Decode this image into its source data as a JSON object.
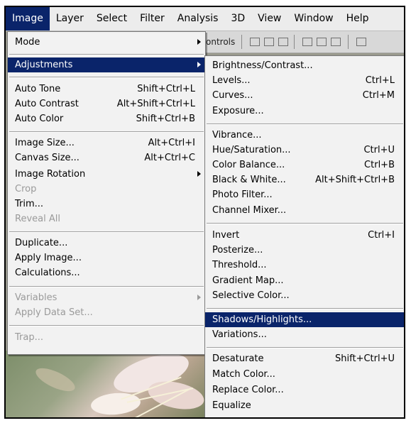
{
  "menubar": {
    "items": [
      "Image",
      "Layer",
      "Select",
      "Filter",
      "Analysis",
      "3D",
      "View",
      "Window",
      "Help"
    ]
  },
  "options_bar": {
    "partial_label": "ontrols"
  },
  "image_menu": {
    "items": [
      {
        "label": "Mode",
        "shortcut": "",
        "submenu": true,
        "disabled": false,
        "highlighted": false
      },
      {
        "label": "Adjustments",
        "shortcut": "",
        "submenu": true,
        "disabled": false,
        "highlighted": true
      },
      {
        "label": "Auto Tone",
        "shortcut": "Shift+Ctrl+L",
        "submenu": false,
        "disabled": false,
        "highlighted": false
      },
      {
        "label": "Auto Contrast",
        "shortcut": "Alt+Shift+Ctrl+L",
        "submenu": false,
        "disabled": false,
        "highlighted": false
      },
      {
        "label": "Auto Color",
        "shortcut": "Shift+Ctrl+B",
        "submenu": false,
        "disabled": false,
        "highlighted": false
      },
      {
        "label": "Image Size...",
        "shortcut": "Alt+Ctrl+I",
        "submenu": false,
        "disabled": false,
        "highlighted": false
      },
      {
        "label": "Canvas Size...",
        "shortcut": "Alt+Ctrl+C",
        "submenu": false,
        "disabled": false,
        "highlighted": false
      },
      {
        "label": "Image Rotation",
        "shortcut": "",
        "submenu": true,
        "disabled": false,
        "highlighted": false
      },
      {
        "label": "Crop",
        "shortcut": "",
        "submenu": false,
        "disabled": true,
        "highlighted": false
      },
      {
        "label": "Trim...",
        "shortcut": "",
        "submenu": false,
        "disabled": false,
        "highlighted": false
      },
      {
        "label": "Reveal All",
        "shortcut": "",
        "submenu": false,
        "disabled": true,
        "highlighted": false
      },
      {
        "label": "Duplicate...",
        "shortcut": "",
        "submenu": false,
        "disabled": false,
        "highlighted": false
      },
      {
        "label": "Apply Image...",
        "shortcut": "",
        "submenu": false,
        "disabled": false,
        "highlighted": false
      },
      {
        "label": "Calculations...",
        "shortcut": "",
        "submenu": false,
        "disabled": false,
        "highlighted": false
      },
      {
        "label": "Variables",
        "shortcut": "",
        "submenu": true,
        "disabled": true,
        "highlighted": false
      },
      {
        "label": "Apply Data Set...",
        "shortcut": "",
        "submenu": false,
        "disabled": true,
        "highlighted": false
      },
      {
        "label": "Trap...",
        "shortcut": "",
        "submenu": false,
        "disabled": true,
        "highlighted": false
      }
    ]
  },
  "adjustments_menu": {
    "items": [
      {
        "label": "Brightness/Contrast...",
        "shortcut": "",
        "highlighted": false
      },
      {
        "label": "Levels...",
        "shortcut": "Ctrl+L",
        "highlighted": false
      },
      {
        "label": "Curves...",
        "shortcut": "Ctrl+M",
        "highlighted": false
      },
      {
        "label": "Exposure...",
        "shortcut": "",
        "highlighted": false
      },
      {
        "label": "Vibrance...",
        "shortcut": "",
        "highlighted": false
      },
      {
        "label": "Hue/Saturation...",
        "shortcut": "Ctrl+U",
        "highlighted": false
      },
      {
        "label": "Color Balance...",
        "shortcut": "Ctrl+B",
        "highlighted": false
      },
      {
        "label": "Black & White...",
        "shortcut": "Alt+Shift+Ctrl+B",
        "highlighted": false
      },
      {
        "label": "Photo Filter...",
        "shortcut": "",
        "highlighted": false
      },
      {
        "label": "Channel Mixer...",
        "shortcut": "",
        "highlighted": false
      },
      {
        "label": "Invert",
        "shortcut": "Ctrl+I",
        "highlighted": false
      },
      {
        "label": "Posterize...",
        "shortcut": "",
        "highlighted": false
      },
      {
        "label": "Threshold...",
        "shortcut": "",
        "highlighted": false
      },
      {
        "label": "Gradient Map...",
        "shortcut": "",
        "highlighted": false
      },
      {
        "label": "Selective Color...",
        "shortcut": "",
        "highlighted": false
      },
      {
        "label": "Shadows/Highlights...",
        "shortcut": "",
        "highlighted": true
      },
      {
        "label": "Variations...",
        "shortcut": "",
        "highlighted": false
      },
      {
        "label": "Desaturate",
        "shortcut": "Shift+Ctrl+U",
        "highlighted": false
      },
      {
        "label": "Match Color...",
        "shortcut": "",
        "highlighted": false
      },
      {
        "label": "Replace Color...",
        "shortcut": "",
        "highlighted": false
      },
      {
        "label": "Equalize",
        "shortcut": "",
        "highlighted": false
      }
    ]
  },
  "colors": {
    "highlight": "#0a246a",
    "menu_bg": "#f2f2f2",
    "disabled_text": "#9a9a9a"
  }
}
